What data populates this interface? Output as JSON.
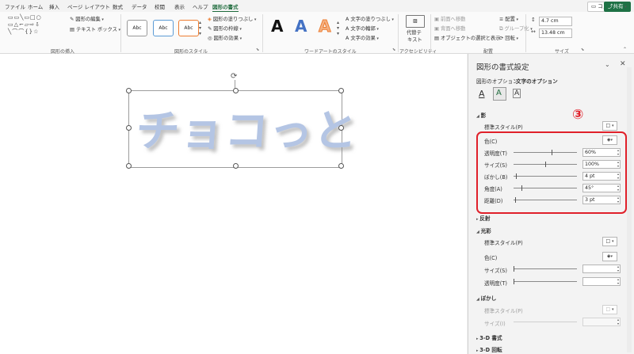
{
  "tabs": [
    "ファイル",
    "ホーム",
    "挿入",
    "ページ レイアウト",
    "数式",
    "データ",
    "校閲",
    "表示",
    "ヘルプ",
    "図形の書式"
  ],
  "active_tab": "図形の書式",
  "comment_label": "コメント",
  "share_label": "共有",
  "ribbon": {
    "insert_shapes": {
      "edit_shape": "図形の編集",
      "text_box": "テキスト ボックス",
      "label": "図形の挿入"
    },
    "shape_styles": {
      "samples": [
        "Abc",
        "Abc",
        "Abc"
      ],
      "fill": "図形の塗りつぶし",
      "outline": "図形の枠線",
      "effects": "図形の効果",
      "label": "図形のスタイル"
    },
    "wordart": {
      "samples": [
        "A",
        "A",
        "A"
      ],
      "text_fill": "文字の塗りつぶし",
      "text_outline": "文字の輪郭",
      "text_effects": "文字の効果",
      "label": "ワードアートのスタイル"
    },
    "accessibility": {
      "alt_text_1": "代替テ",
      "alt_text_2": "キスト",
      "label": "アクセシビリティ"
    },
    "arrange": {
      "bring_forward": "前面へ移動",
      "send_backward": "背面へ移動",
      "selection_pane": "オブジェクトの選択と表示",
      "align": "配置",
      "group": "グループ化",
      "rotate": "回転",
      "label": "配置"
    },
    "size": {
      "height": "4.7 cm",
      "width": "13.48 cm",
      "label": "サイズ"
    }
  },
  "shape_text": "チョコっと",
  "pane": {
    "title": "図形の書式設定",
    "tab_shape": "図形のオプション",
    "tab_text": "文字のオプション",
    "shadow": {
      "header": "影",
      "preset": "標準スタイル(P)",
      "color": "色(C)",
      "rows": [
        {
          "label": "透明度(T)",
          "value": "60%",
          "slider": 0.6
        },
        {
          "label": "サイズ(S)",
          "value": "100%",
          "slider": 0.5
        },
        {
          "label": "ぼかし(B)",
          "value": "4 pt",
          "slider": 0.04
        },
        {
          "label": "角度(A)",
          "value": "45°",
          "slider": 0.12
        },
        {
          "label": "距離(D)",
          "value": "3 pt",
          "slider": 0.03
        }
      ]
    },
    "reflection": "反射",
    "glow": {
      "header": "光彩",
      "preset": "標準スタイル(P)",
      "color": "色(C)",
      "size": "サイズ(S)",
      "transparency": "透明度(T)"
    },
    "soft_edges": {
      "header": "ぼかし",
      "preset": "標準スタイル(P)",
      "size": "サイズ(I)"
    },
    "format_3d": "3-D 書式",
    "rotation_3d": "3-D 回転"
  },
  "annotation_number": "③",
  "colors": {
    "accent": "#1e6b3c",
    "highlight": "#e0202a",
    "text_fill": "#b4c5e4"
  }
}
